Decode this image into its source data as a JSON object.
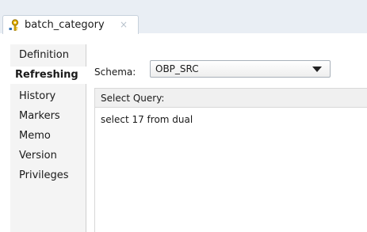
{
  "tab": {
    "title": "batch_category",
    "close_glyph": "×",
    "icon": "key-lock-icon"
  },
  "sidenav": {
    "items": [
      {
        "label": "Definition",
        "active": false
      },
      {
        "label": "Refreshing",
        "active": true
      },
      {
        "label": "History",
        "active": false
      },
      {
        "label": "Markers",
        "active": false
      },
      {
        "label": "Memo",
        "active": false
      },
      {
        "label": "Version",
        "active": false
      },
      {
        "label": "Privileges",
        "active": false
      }
    ]
  },
  "schema": {
    "label": "Schema:",
    "value": "OBP_SRC"
  },
  "query": {
    "header": "Select Query:",
    "text": "select 17 from dual"
  },
  "colors": {
    "tabbar_bg": "#e9eef4",
    "sidenav_bg": "#f4f4f4",
    "active_bg": "#ffffff"
  }
}
